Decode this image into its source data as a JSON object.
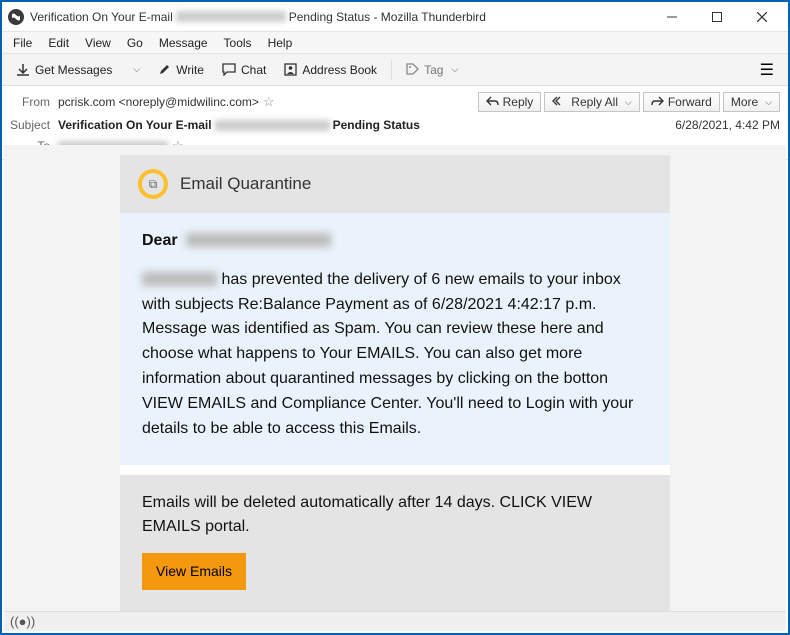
{
  "window": {
    "title_prefix": "Verification On Your E-mail",
    "title_suffix": "Pending Status - Mozilla Thunderbird"
  },
  "menubar": [
    "File",
    "Edit",
    "View",
    "Go",
    "Message",
    "Tools",
    "Help"
  ],
  "toolbar": {
    "get_messages": "Get Messages",
    "write": "Write",
    "chat": "Chat",
    "address_book": "Address Book",
    "tag": "Tag"
  },
  "header": {
    "from_label": "From",
    "from_value": "pcrisk.com <noreply@midwilinc.com>",
    "subject_label": "Subject",
    "subject_prefix": "Verification On Your E-mail",
    "subject_suffix": "Pending Status",
    "date": "6/28/2021, 4:42 PM",
    "to_label": "To",
    "actions": {
      "reply": "Reply",
      "reply_all": "Reply All",
      "forward": "Forward",
      "more": "More"
    }
  },
  "email": {
    "quarantine_title": "Email Quarantine",
    "dear": "Dear",
    "body_1": " has prevented the delivery of 6 new emails to your inbox with subjects Re:Balance Payment as of 6/28/2021 4:42:17 p.m. Message was identified as Spam. You can review these here and choose what happens to Your EMAILS. You can also get more information about quarantined messages by clicking on the botton VIEW EMAILS and Compliance Center. You'll need to Login with your details to be able to access this Emails.",
    "footer_text": "Emails will be deleted automatically after 14 days. CLICK VIEW EMAILS portal.",
    "view_button": "View Emails"
  }
}
